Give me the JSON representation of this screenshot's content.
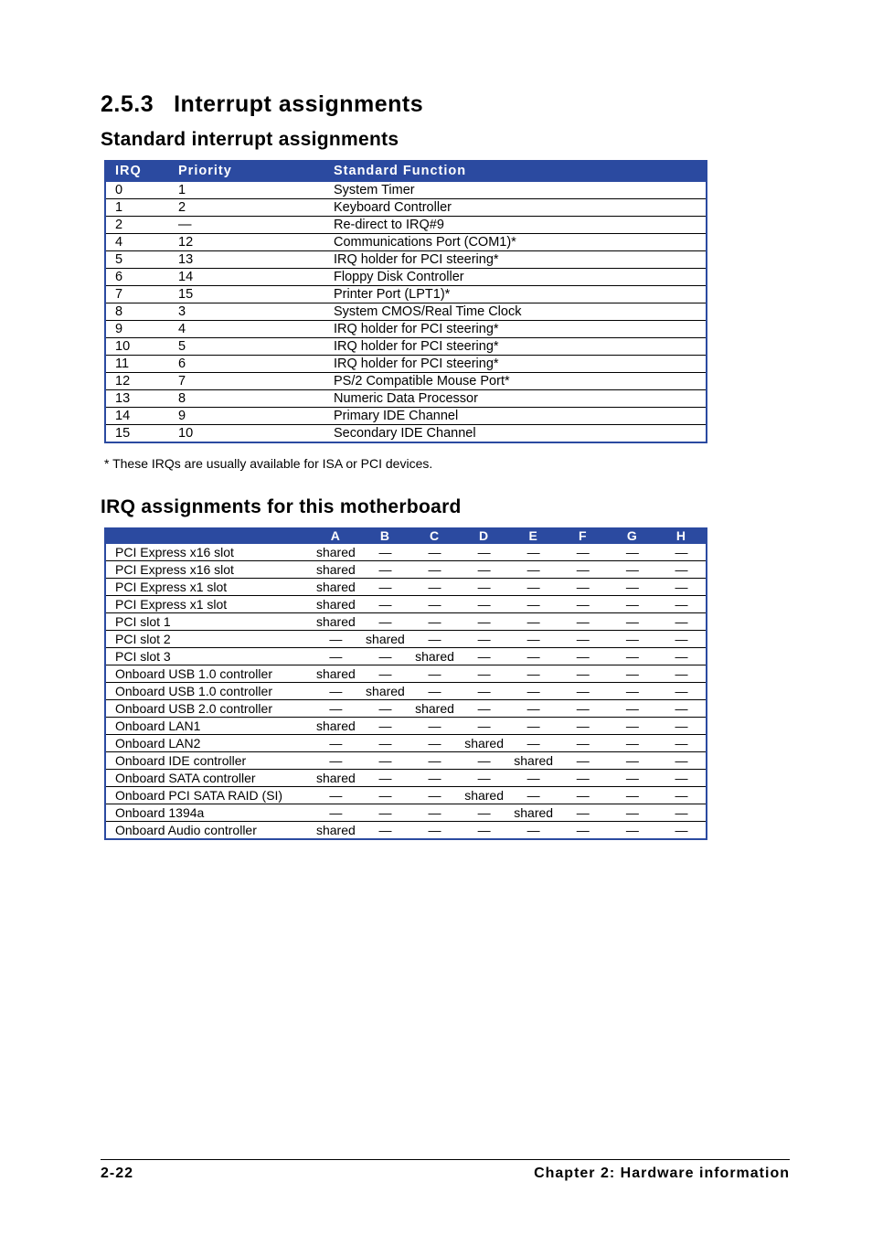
{
  "section_number": "2.5.3",
  "section_title": "Interrupt assignments",
  "subheading1": "Standard interrupt assignments",
  "table1": {
    "headers": {
      "irq": "IRQ",
      "priority": "Priority",
      "func": "Standard Function"
    },
    "rows": [
      {
        "irq": "0",
        "priority": "1",
        "func": "System Timer"
      },
      {
        "irq": "1",
        "priority": "2",
        "func": "Keyboard Controller"
      },
      {
        "irq": "2",
        "priority": "—",
        "func": "Re-direct to IRQ#9"
      },
      {
        "irq": "4",
        "priority": "12",
        "func": "Communications Port (COM1)*"
      },
      {
        "irq": "5",
        "priority": "13",
        "func": "IRQ holder for PCI steering*"
      },
      {
        "irq": "6",
        "priority": "14",
        "func": "Floppy Disk Controller"
      },
      {
        "irq": "7",
        "priority": "15",
        "func": "Printer Port (LPT1)*"
      },
      {
        "irq": "8",
        "priority": "3",
        "func": "System CMOS/Real Time Clock"
      },
      {
        "irq": "9",
        "priority": "4",
        "func": "IRQ holder for PCI steering*"
      },
      {
        "irq": "10",
        "priority": "5",
        "func": "IRQ holder for PCI steering*"
      },
      {
        "irq": "11",
        "priority": "6",
        "func": "IRQ holder for PCI steering*"
      },
      {
        "irq": "12",
        "priority": "7",
        "func": "PS/2 Compatible Mouse Port*"
      },
      {
        "irq": "13",
        "priority": "8",
        "func": "Numeric Data Processor"
      },
      {
        "irq": "14",
        "priority": "9",
        "func": "Primary IDE Channel"
      },
      {
        "irq": "15",
        "priority": "10",
        "func": "Secondary IDE Channel"
      }
    ]
  },
  "footnote": "* These IRQs are usually available for ISA or PCI devices.",
  "subheading2": "IRQ assignments for this motherboard",
  "table2": {
    "headers": [
      "",
      "A",
      "B",
      "C",
      "D",
      "E",
      "F",
      "G",
      "H"
    ],
    "rows": [
      {
        "label": "PCI Express x16 slot",
        "vals": [
          "shared",
          "—",
          "—",
          "—",
          "—",
          "—",
          "—",
          "—"
        ]
      },
      {
        "label": "PCI Express x16 slot",
        "vals": [
          "shared",
          "—",
          "—",
          "—",
          "—",
          "—",
          "—",
          "—"
        ]
      },
      {
        "label": "PCI Express x1 slot",
        "vals": [
          "shared",
          "—",
          "—",
          "—",
          "—",
          "—",
          "—",
          "—"
        ]
      },
      {
        "label": "PCI Express x1 slot",
        "vals": [
          "shared",
          "—",
          "—",
          "—",
          "—",
          "—",
          "—",
          "—"
        ]
      },
      {
        "label": "PCI slot 1",
        "vals": [
          "shared",
          "—",
          "—",
          "—",
          "—",
          "—",
          "—",
          "—"
        ]
      },
      {
        "label": "PCI slot 2",
        "vals": [
          "—",
          "shared",
          "—",
          "—",
          "—",
          "—",
          "—",
          "—"
        ]
      },
      {
        "label": "PCI slot 3",
        "vals": [
          "—",
          "—",
          "shared",
          "—",
          "—",
          "—",
          "—",
          "—"
        ]
      },
      {
        "label": "Onboard USB 1.0 controller",
        "vals": [
          "shared",
          "—",
          "—",
          "—",
          "—",
          "—",
          "—",
          "—"
        ]
      },
      {
        "label": "Onboard USB 1.0 controller",
        "vals": [
          "—",
          "shared",
          "—",
          "—",
          "—",
          "—",
          "—",
          "—"
        ]
      },
      {
        "label": "Onboard USB 2.0 controller",
        "vals": [
          "—",
          "—",
          "shared",
          "—",
          "—",
          "—",
          "—",
          "—"
        ]
      },
      {
        "label": "Onboard LAN1",
        "vals": [
          "shared",
          "—",
          "—",
          "—",
          "—",
          "—",
          "—",
          "—"
        ]
      },
      {
        "label": "Onboard LAN2",
        "vals": [
          "—",
          "—",
          "—",
          "shared",
          "—",
          "—",
          "—",
          "—"
        ]
      },
      {
        "label": "Onboard IDE controller",
        "vals": [
          "—",
          "—",
          "—",
          "—",
          "shared",
          "—",
          "—",
          "—"
        ]
      },
      {
        "label": "Onboard SATA controller",
        "vals": [
          "shared",
          "—",
          "—",
          "—",
          "—",
          "—",
          "—",
          "—"
        ]
      },
      {
        "label": "Onboard PCI SATA RAID (SI)",
        "vals": [
          "—",
          "—",
          "—",
          "shared",
          "—",
          "—",
          "—",
          "—"
        ]
      },
      {
        "label": "Onboard 1394a",
        "vals": [
          "—",
          "—",
          "—",
          "—",
          "shared",
          "—",
          "—",
          "—"
        ]
      },
      {
        "label": "Onboard Audio controller",
        "vals": [
          "shared",
          "—",
          "—",
          "—",
          "—",
          "—",
          "—",
          "—"
        ]
      }
    ]
  },
  "footer": {
    "page": "2-22",
    "chapter": "Chapter 2: Hardware information"
  }
}
